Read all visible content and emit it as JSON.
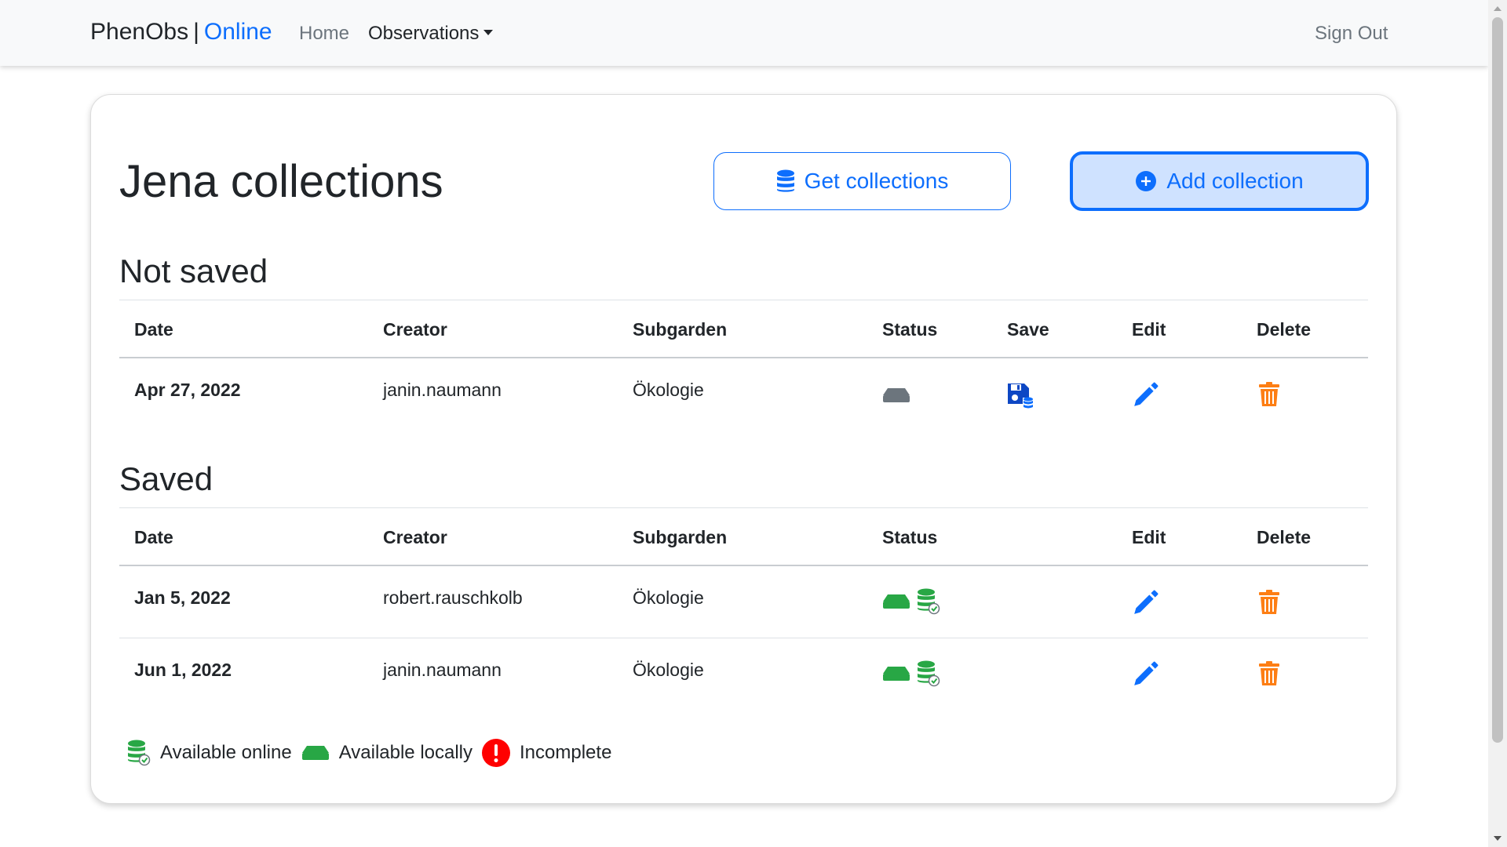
{
  "navbar": {
    "brand_name": "PhenObs",
    "brand_separator": "|",
    "brand_suffix": "Online",
    "home_label": "Home",
    "observations_label": "Observations",
    "signout_label": "Sign Out"
  },
  "page": {
    "title": "Jena collections",
    "get_collections_label": "Get collections",
    "add_collection_label": "Add collection"
  },
  "not_saved": {
    "title": "Not saved",
    "headers": [
      "Date",
      "Creator",
      "Subgarden",
      "Status",
      "Save",
      "Edit",
      "Delete"
    ],
    "rows": [
      {
        "date": "Apr 27, 2022",
        "creator": "janin.naumann",
        "subgarden": "Ökologie",
        "status": [
          "local-drive-grey-icon"
        ]
      }
    ]
  },
  "saved": {
    "title": "Saved",
    "headers": [
      "Date",
      "Creator",
      "Subgarden",
      "Status",
      "Edit",
      "Delete"
    ],
    "rows": [
      {
        "date": "Jan 5, 2022",
        "creator": "robert.rauschkolb",
        "subgarden": "Ökologie",
        "status": [
          "local-drive-green-icon",
          "online-database-green-icon"
        ]
      },
      {
        "date": "Jun 1, 2022",
        "creator": "janin.naumann",
        "subgarden": "Ökologie",
        "status": [
          "local-drive-green-icon",
          "online-database-green-icon"
        ]
      }
    ]
  },
  "legend": {
    "online_label": "Available online",
    "local_label": "Available locally",
    "incomplete_label": "Incomplete"
  },
  "colors": {
    "primary": "#0d6efd",
    "success": "#28a745",
    "warning": "#fd7e14",
    "danger": "#ff0000",
    "muted": "#6c757d"
  }
}
